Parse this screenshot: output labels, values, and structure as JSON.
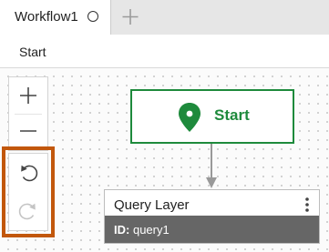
{
  "tabs": [
    {
      "title": "Workflow1"
    }
  ],
  "breadcrumb": {
    "label": "Start"
  },
  "canvas": {
    "start_node": {
      "label": "Start"
    },
    "query_node": {
      "title": "Query Layer",
      "id_label": "ID:",
      "id_value": "query1"
    }
  },
  "icons": {
    "unsaved": "circle-icon",
    "new_tab": "plus-icon",
    "zoom_in": "plus-icon",
    "zoom_out": "minus-icon",
    "undo": "undo-icon",
    "redo": "redo-icon",
    "start": "map-pin-icon",
    "menu": "vertical-ellipsis-icon"
  },
  "colors": {
    "start_green": "#1e8a3c",
    "highlight_orange": "#c2570c",
    "footer_gray": "#666666"
  }
}
